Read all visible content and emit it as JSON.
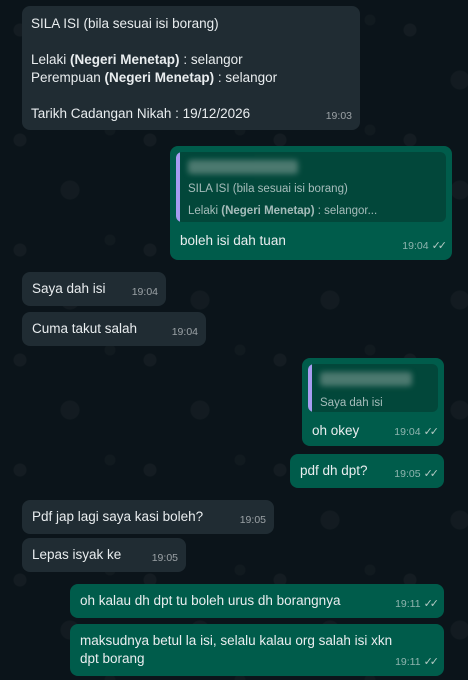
{
  "messages": {
    "m1": {
      "line1": "SILA ISI (bila sesuai isi borang)",
      "line2_pre": "Lelaki ",
      "line2_bold": "(Negeri Menetap)",
      "line2_post": " : selangor",
      "line3_pre": "Perempuan ",
      "line3_bold": "(Negeri Menetap)",
      "line3_post": " : selangor",
      "line4": "Tarikh Cadangan Nikah : 19/12/2026",
      "time": "19:03"
    },
    "m2": {
      "quote_line1": "SILA ISI (bila sesuai isi borang)",
      "quote_line2_pre": "Lelaki ",
      "quote_line2_bold": "(Negeri Menetap)",
      "quote_line2_post": " : selangor...",
      "text": "boleh isi dah tuan",
      "time": "19:04",
      "ticks": "✓✓"
    },
    "m3": {
      "text": "Saya dah isi",
      "time": "19:04"
    },
    "m4": {
      "text": "Cuma takut salah",
      "time": "19:04"
    },
    "m5": {
      "quote_line1": "Saya dah isi",
      "text": "oh okey",
      "time": "19:04",
      "ticks": "✓✓"
    },
    "m6": {
      "text": "pdf dh dpt?",
      "time": "19:05",
      "ticks": "✓✓"
    },
    "m7": {
      "text": "Pdf jap lagi saya kasi boleh?",
      "time": "19:05"
    },
    "m8": {
      "text": "Lepas isyak ke",
      "time": "19:05"
    },
    "m9": {
      "text": "oh kalau dh dpt tu boleh urus dh borangnya",
      "time": "19:11",
      "ticks": "✓✓"
    },
    "m10": {
      "line1": "maksudnya betul la isi, selalu kalau org salah isi xkn",
      "line2": "dpt borang",
      "time": "19:11",
      "ticks": "✓✓"
    }
  },
  "colors": {
    "background": "#0b141a",
    "incoming_bubble": "#202c33",
    "outgoing_bubble": "#005c4b",
    "quote_bar": "#a79cf1"
  }
}
